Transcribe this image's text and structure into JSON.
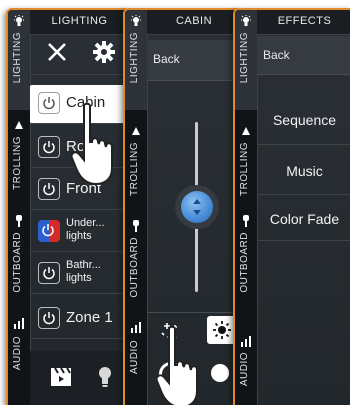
{
  "rail_tabs": {
    "lighting": "LIGHTING",
    "trolling": "TROLLING",
    "outboard": "OUTBOARD",
    "audio": "AUDIO"
  },
  "panel1": {
    "title": "LIGHTING",
    "zones": [
      {
        "label": "Cabin",
        "selected": true
      },
      {
        "label": "Ro",
        "selected": false
      },
      {
        "label": "Front",
        "selected": false
      },
      {
        "label": "Under...",
        "label2": "lights",
        "colored": true
      },
      {
        "label": "Bathr...",
        "label2": "lights"
      },
      {
        "label": "Zone 1"
      }
    ]
  },
  "panel2": {
    "title": "CABIN",
    "back_label": "Back",
    "dimmer_level": 0.5
  },
  "panel3": {
    "title": "EFFECTS",
    "back_label": "Back",
    "effects": [
      "Sequence",
      "Music",
      "Color Fade"
    ]
  },
  "colors": {
    "border": "#e08a2a",
    "selected_row": "#ffffff",
    "knob": "#4a8fd8"
  }
}
